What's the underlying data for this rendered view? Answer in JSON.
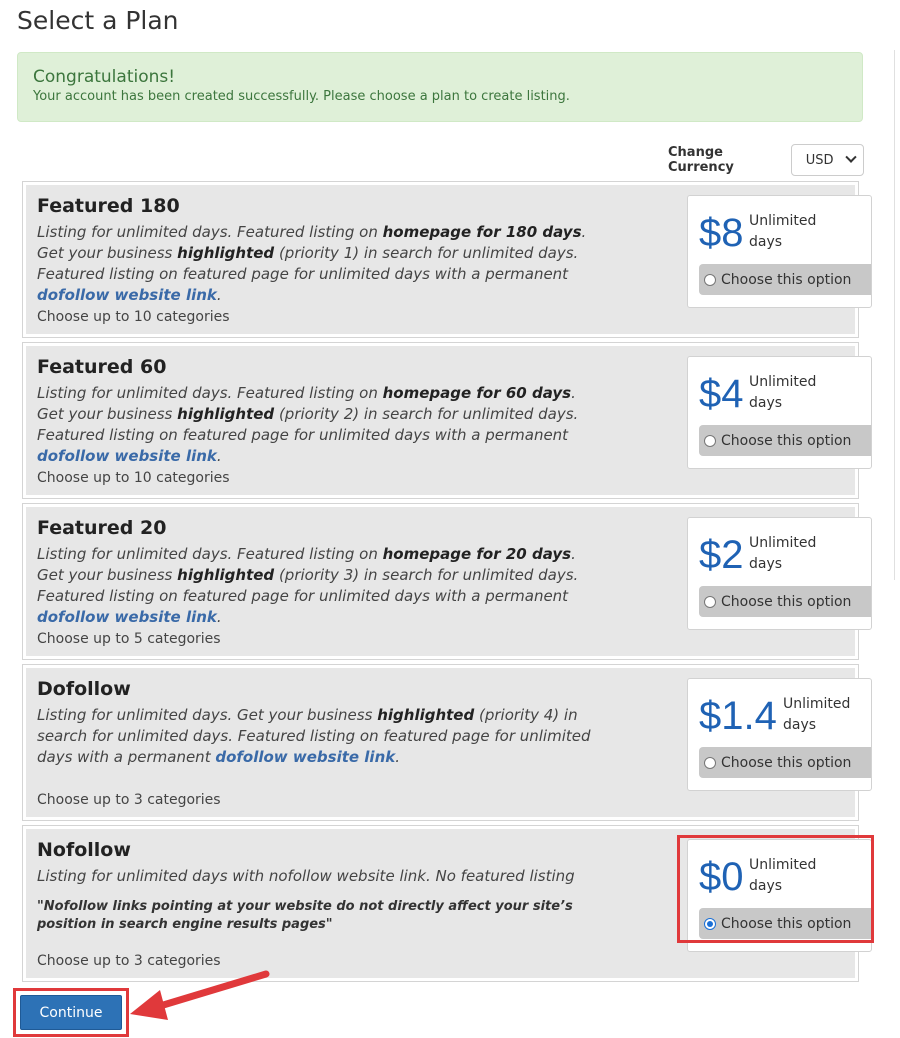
{
  "page": {
    "title": "Select a Plan"
  },
  "alert": {
    "title": "Congratulations!",
    "text": "Your account has been created successfully. Please choose a plan to create listing."
  },
  "currency": {
    "label": "Change Currency",
    "selected": "USD"
  },
  "plans": [
    {
      "name": "Featured 180",
      "desc": [
        "Listing for unlimited days. Featured listing on ",
        "homepage for 180 days",
        ". Get your business ",
        "highlighted",
        " (priority 1) in search for unlimited days. Featured listing on featured page for unlimited days with a permanent ",
        "dofollow website link",
        "."
      ],
      "categories": "Choose up to 10 categories",
      "price": "$8",
      "unit": "Unlimited days",
      "choose_label": "Choose this option",
      "selected": false
    },
    {
      "name": "Featured 60",
      "desc": [
        "Listing for unlimited days. Featured listing on ",
        "homepage for 60 days",
        ". Get your business ",
        "highlighted",
        " (priority 2) in search for unlimited days. Featured listing on featured page for unlimited days with a permanent ",
        "dofollow website link",
        "."
      ],
      "categories": "Choose up to 10 categories",
      "price": "$4",
      "unit": "Unlimited days",
      "choose_label": "Choose this option",
      "selected": false
    },
    {
      "name": "Featured 20",
      "desc": [
        "Listing for unlimited days. Featured listing on ",
        "homepage for 20 days",
        ". Get your business ",
        "highlighted",
        " (priority 3) in search for unlimited days. Featured listing on featured page for unlimited days with a permanent ",
        "dofollow website link",
        "."
      ],
      "categories": "Choose up to 5 categories",
      "price": "$2",
      "unit": "Unlimited days",
      "choose_label": "Choose this option",
      "selected": false
    },
    {
      "name": "Dofollow",
      "desc": [
        "Listing for unlimited days. Get your business ",
        "highlighted",
        " (priority 4) in search for unlimited days. Featured listing on featured page for unlimited days with a permanent ",
        "dofollow website link",
        "."
      ],
      "categories": "Choose up to 3 categories",
      "price": "$1.4",
      "unit": "Unlimited days",
      "choose_label": "Choose this option",
      "selected": false
    },
    {
      "name": "Nofollow",
      "desc_plain": "Listing for unlimited days with nofollow website link. No featured listing",
      "quote": "\"Nofollow links pointing at your website do not directly affect your site’s position in search engine results pages\"",
      "categories": "Choose up to 3 categories",
      "price": "$0",
      "unit": "Unlimited days",
      "choose_label": "Choose this option",
      "selected": true
    }
  ],
  "continue_label": "Continue",
  "colors": {
    "accent": "#1f62b4",
    "button": "#2d72b6",
    "highlight": "#e0393b",
    "alert_bg": "#dff0d8"
  }
}
